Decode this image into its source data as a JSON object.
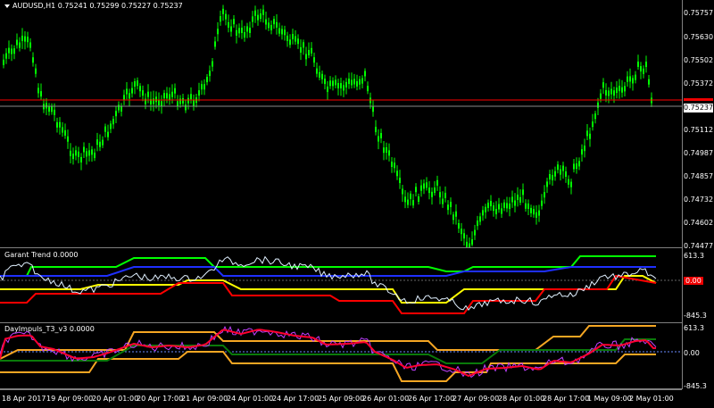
{
  "main": {
    "symbol": "AUDUSD,H1",
    "ohlc": "0.75241 0.75299 0.75227 0.75237",
    "price_ticks": [
      "0.75757",
      "0.75630",
      "0.75502",
      "0.75372",
      "0.75112",
      "0.74987",
      "0.74857",
      "0.74732",
      "0.74602",
      "0.74477"
    ],
    "current_price": "0.75237",
    "colors": {
      "candle": "#00ff00",
      "bid_line": "#ff0000",
      "ask_line": "#888888"
    }
  },
  "garant": {
    "title": "Garant Trend 0.0000",
    "ticks": [
      "613.3",
      "0.00",
      "-845.3"
    ],
    "colors": {
      "green": "#00ff00",
      "blue": "#1e2fff",
      "yellow": "#ffff00",
      "red": "#ff0000",
      "white": "#e0f0ff",
      "orange": "#ffa500"
    }
  },
  "dayimpuls": {
    "title": "DayImpuls_T3_v3 0.0000",
    "ticks": [
      "613.3",
      "0.00",
      "-845.3"
    ],
    "colors": {
      "orange": "#f5a623",
      "green": "#0a7a0a",
      "red": "#ff0030",
      "magenta": "#c040ff",
      "zero": "#6a8cff"
    }
  },
  "time_axis": [
    "18 Apr 2017",
    "19 Apr 09:00",
    "20 Apr 01:00",
    "20 Apr 17:00",
    "21 Apr 09:00",
    "24 Apr 01:00",
    "24 Apr 17:00",
    "25 Apr 09:00",
    "26 Apr 01:00",
    "26 Apr 17:00",
    "27 Apr 09:00",
    "28 Apr 01:00",
    "28 Apr 17:00",
    "1 May 09:00",
    "2 May 01:00"
  ]
}
